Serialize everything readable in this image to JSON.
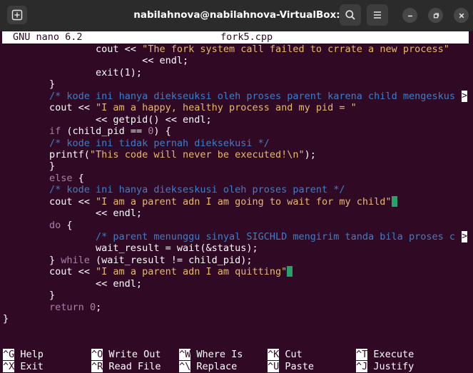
{
  "window": {
    "title": "nabilahnova@nabilahnova-VirtualBox: ~"
  },
  "icons": {
    "new_tab": "new-tab-icon",
    "search": "search-icon",
    "menu": "hamburger-menu-icon",
    "minimize": "minimize-icon",
    "maximize": "maximize-icon",
    "close": "close-icon"
  },
  "nano": {
    "version": "GNU nano 6.2",
    "filename": "fork5.cpp",
    "truncation_marker": ">"
  },
  "code_lines": [
    [
      {
        "t": "                cout << ",
        "c": ""
      },
      {
        "t": "\"The fork system call failed to crrate a new process\"",
        "c": "str"
      }
    ],
    [
      {
        "t": "                        << endl;",
        "c": ""
      }
    ],
    [
      {
        "t": "                exit(1);",
        "c": ""
      }
    ],
    [
      {
        "t": "        }",
        "c": ""
      }
    ],
    [
      {
        "t": "        ",
        "c": ""
      },
      {
        "t": "/* kode ini hanya diekseuksi oleh proses parent karena child mengeskus",
        "c": "cmt"
      }
    ],
    [
      {
        "t": "        cout << ",
        "c": ""
      },
      {
        "t": "\"I am a happy, healthy process and my pid = \"",
        "c": "str"
      }
    ],
    [
      {
        "t": "                << getpid() << endl;",
        "c": ""
      }
    ],
    [
      {
        "t": "        ",
        "c": ""
      },
      {
        "t": "if",
        "c": "kw"
      },
      {
        "t": " (child_pid == ",
        "c": ""
      },
      {
        "t": "0",
        "c": "kw"
      },
      {
        "t": ") {",
        "c": ""
      }
    ],
    [
      {
        "t": "        ",
        "c": ""
      },
      {
        "t": "/* kode ini tidak pernah dieksekusi */",
        "c": "cmt"
      }
    ],
    [
      {
        "t": "        printf(",
        "c": ""
      },
      {
        "t": "\"This code will never be executed!\\n\"",
        "c": "str"
      },
      {
        "t": ");",
        "c": ""
      }
    ],
    [
      {
        "t": "        }",
        "c": ""
      }
    ],
    [
      {
        "t": "        ",
        "c": ""
      },
      {
        "t": "else",
        "c": "kw"
      },
      {
        "t": " {",
        "c": ""
      }
    ],
    [
      {
        "t": "        ",
        "c": ""
      },
      {
        "t": "/* kode ini hanya diekseskusi oleh proses parent */",
        "c": "cmt"
      }
    ],
    [
      {
        "t": "        cout << ",
        "c": ""
      },
      {
        "t": "\"I am a parent adn I am going to wait for my child\"",
        "c": "str"
      },
      {
        "t": "",
        "c": "cur"
      }
    ],
    [
      {
        "t": "                << endl;",
        "c": ""
      }
    ],
    [
      {
        "t": "        ",
        "c": ""
      },
      {
        "t": "do",
        "c": "kw"
      },
      {
        "t": " {",
        "c": ""
      }
    ],
    [
      {
        "t": "                ",
        "c": ""
      },
      {
        "t": "/* parent menunggu sinyal SIGCHLD mengirim tanda bila proses c",
        "c": "cmt"
      }
    ],
    [
      {
        "t": "                wait_result = wait(&status);",
        "c": ""
      }
    ],
    [
      {
        "t": "        } ",
        "c": ""
      },
      {
        "t": "while",
        "c": "kw"
      },
      {
        "t": " (wait_result != child_pid);",
        "c": ""
      }
    ],
    [
      {
        "t": "        cout << ",
        "c": ""
      },
      {
        "t": "\"I am a parent adn I am quitting\"",
        "c": "str"
      },
      {
        "t": "",
        "c": "cur"
      }
    ],
    [
      {
        "t": "                << endl;",
        "c": ""
      }
    ],
    [
      {
        "t": "        }",
        "c": ""
      }
    ],
    [
      {
        "t": "        ",
        "c": ""
      },
      {
        "t": "return",
        "c": "kw"
      },
      {
        "t": " ",
        "c": ""
      },
      {
        "t": "0",
        "c": "kw"
      },
      {
        "t": ";",
        "c": ""
      }
    ],
    [
      {
        "t": "}",
        "c": ""
      }
    ]
  ],
  "shortcuts": [
    {
      "key": "^G",
      "label": " Help"
    },
    {
      "key": "^O",
      "label": " Write Out"
    },
    {
      "key": "^W",
      "label": " Where Is"
    },
    {
      "key": "^K",
      "label": " Cut"
    },
    {
      "key": "^T",
      "label": " Execute"
    },
    {
      "key": "^X",
      "label": " Exit"
    },
    {
      "key": "^R",
      "label": " Read File"
    },
    {
      "key": "^\\",
      "label": " Replace"
    },
    {
      "key": "^U",
      "label": " Paste"
    },
    {
      "key": "^J",
      "label": " Justify"
    }
  ],
  "colors": {
    "terminal_bg": "#300a24",
    "titlebar_bg": "#2b2b2b",
    "string": "#e9b96e",
    "comment": "#3c7fc9",
    "keyword": "#ad7fa8",
    "cursor": "#26a269"
  }
}
